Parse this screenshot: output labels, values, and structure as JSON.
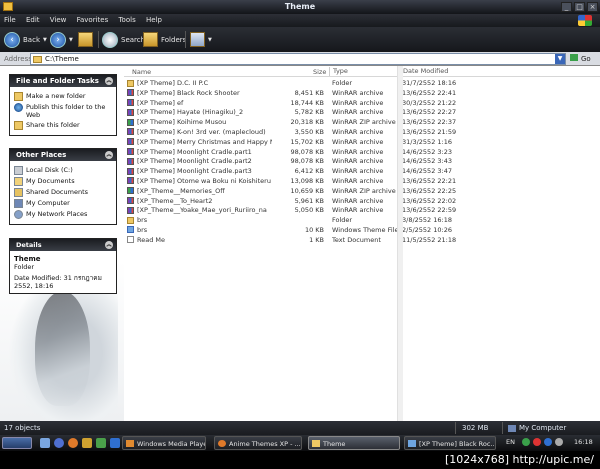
{
  "window": {
    "title": "Theme"
  },
  "menu": [
    "File",
    "Edit",
    "View",
    "Favorites",
    "Tools",
    "Help"
  ],
  "toolbar": {
    "back": "Back",
    "search": "Search",
    "folders": "Folders"
  },
  "address": {
    "label": "Address",
    "path": "C:\\Theme",
    "go": "Go"
  },
  "tasks": {
    "file_folder": {
      "title": "File and Folder Tasks",
      "items": [
        "Make a new folder",
        "Publish this folder to the Web",
        "Share this folder"
      ]
    },
    "other_places": {
      "title": "Other Places",
      "items": [
        "Local Disk (C:)",
        "My Documents",
        "Shared Documents",
        "My Computer",
        "My Network Places"
      ]
    },
    "details": {
      "title": "Details",
      "name": "Theme",
      "kind": "Folder",
      "modified": "Date Modified: 31 กรกฎาคม 2552, 18:16"
    }
  },
  "columns": {
    "name": "Name",
    "size": "Size",
    "type": "Type",
    "date": "Date Modified"
  },
  "files": [
    {
      "name": "[XP Theme] D.C. II P.C",
      "size": "",
      "type": "Folder",
      "date": "31/7/2552 18:16",
      "icon": "folder"
    },
    {
      "name": "[XP Theme] Black Rock Shooter",
      "size": "8,451 KB",
      "type": "WinRAR archive",
      "date": "13/6/2552 22:41",
      "icon": "rar"
    },
    {
      "name": "[XP Theme] ef",
      "size": "18,744 KB",
      "type": "WinRAR archive",
      "date": "30/3/2552 21:22",
      "icon": "rar"
    },
    {
      "name": "[XP Theme] Hayate (Hinagiku)_2",
      "size": "5,782 KB",
      "type": "WinRAR archive",
      "date": "13/6/2552 22:27",
      "icon": "rar"
    },
    {
      "name": "[XP Theme] Koihime Musou",
      "size": "20,318 KB",
      "type": "WinRAR ZIP archive",
      "date": "13/6/2552 22:37",
      "icon": "zip"
    },
    {
      "name": "[XP Theme] K-on! 3rd ver. (maplecloud)",
      "size": "3,550 KB",
      "type": "WinRAR archive",
      "date": "13/6/2552 21:59",
      "icon": "rar"
    },
    {
      "name": "[XP Theme] Merry Christmas and Happy New ...",
      "size": "15,702 KB",
      "type": "WinRAR archive",
      "date": "31/3/2552 1:16",
      "icon": "rar"
    },
    {
      "name": "[XP Theme] Moonlight Cradle.part1",
      "size": "98,078 KB",
      "type": "WinRAR archive",
      "date": "14/6/2552 3:23",
      "icon": "rar"
    },
    {
      "name": "[XP Theme] Moonlight Cradle.part2",
      "size": "98,078 KB",
      "type": "WinRAR archive",
      "date": "14/6/2552 3:43",
      "icon": "rar"
    },
    {
      "name": "[XP Theme] Moonlight Cradle.part3",
      "size": "6,412 KB",
      "type": "WinRAR archive",
      "date": "14/6/2552 3:47",
      "icon": "rar"
    },
    {
      "name": "[XP Theme] Otome wa Boku ni Koishiteru (FIX)",
      "size": "13,098 KB",
      "type": "WinRAR archive",
      "date": "13/6/2552 22:21",
      "icon": "rar"
    },
    {
      "name": "[XP_Theme__Memories_Off",
      "size": "10,659 KB",
      "type": "WinRAR ZIP archive",
      "date": "13/6/2552 22:25",
      "icon": "zip"
    },
    {
      "name": "[XP_Theme__To_Heart2",
      "size": "5,961 KB",
      "type": "WinRAR archive",
      "date": "13/6/2552 22:02",
      "icon": "rar"
    },
    {
      "name": "[XP_Theme__Yoake_Mae_yori_Ruriiro_na",
      "size": "5,050 KB",
      "type": "WinRAR archive",
      "date": "13/6/2552 22:59",
      "icon": "rar"
    },
    {
      "name": "brs",
      "size": "",
      "type": "Folder",
      "date": "3/8/2552 16:18",
      "icon": "folder"
    },
    {
      "name": "brs",
      "size": "10 KB",
      "type": "Windows Theme File",
      "date": "2/5/2552 10:26",
      "icon": "theme"
    },
    {
      "name": "Read Me",
      "size": "1 KB",
      "type": "Text Document",
      "date": "11/5/2552 21:18",
      "icon": "doc"
    }
  ],
  "status": {
    "objects": "17 objects",
    "size": "302 MB",
    "location": "My Computer"
  },
  "taskbar": {
    "tasks": [
      "Windows Media Player",
      "Anime Themes XP - ...",
      "Theme",
      "[XP Theme] Black Roc..."
    ],
    "lang": "EN",
    "clock": "16:18"
  },
  "watermark": "[1024x768] http://upic.me/"
}
